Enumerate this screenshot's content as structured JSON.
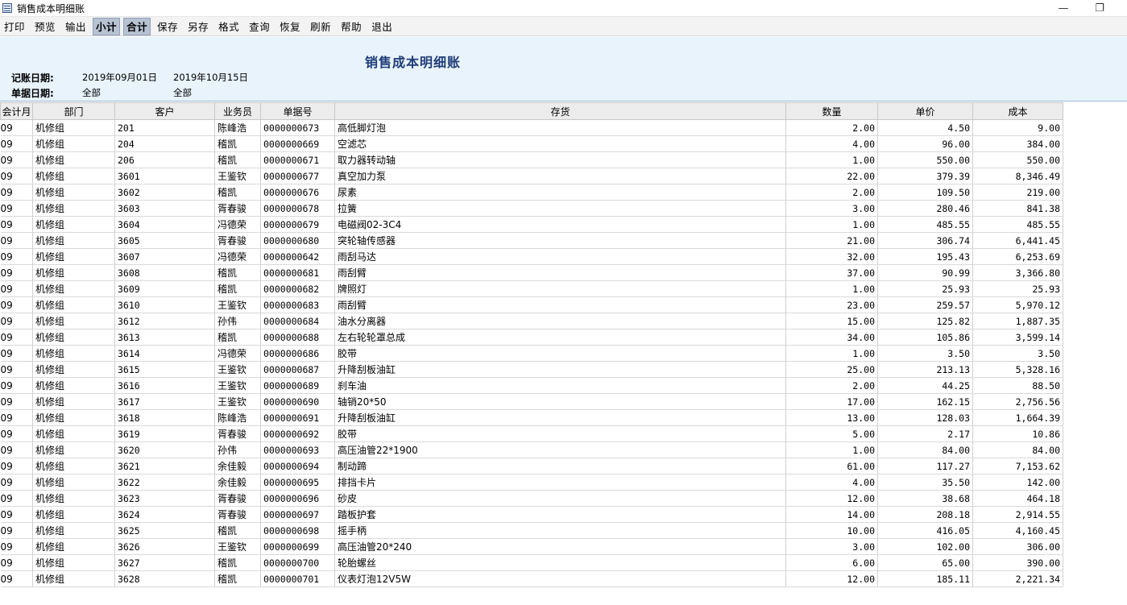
{
  "window": {
    "title": "销售成本明细账"
  },
  "toolbar": [
    "打印",
    "预览",
    "输出",
    "小计",
    "合计",
    "保存",
    "另存",
    "格式",
    "查询",
    "恢复",
    "刷新",
    "帮助",
    "退出"
  ],
  "toolbar_active": [
    "小计",
    "合计"
  ],
  "report": {
    "title": "销售成本明细账",
    "date_label": "记账日期:",
    "date_from": "2019年09月01日",
    "date_to": "2019年10月15日",
    "doc_date_label": "单据日期:",
    "doc_date_from": "全部",
    "doc_date_to": "全部"
  },
  "table": {
    "columns": [
      "会计月",
      "部门",
      "客户",
      "业务员",
      "单据号",
      "存货",
      "数量",
      "单价",
      "成本"
    ],
    "rows": [
      [
        "09",
        "机修组",
        "201",
        "陈峰浩",
        "0000000673",
        "高低脚灯泡",
        "2.00",
        "4.50",
        "9.00"
      ],
      [
        "09",
        "机修组",
        "204",
        "稽凯",
        "0000000669",
        "空滤芯",
        "4.00",
        "96.00",
        "384.00"
      ],
      [
        "09",
        "机修组",
        "206",
        "稽凯",
        "0000000671",
        "取力器转动轴",
        "1.00",
        "550.00",
        "550.00"
      ],
      [
        "09",
        "机修组",
        "3601",
        "王鉴钦",
        "0000000677",
        "真空加力泵",
        "22.00",
        "379.39",
        "8,346.49"
      ],
      [
        "09",
        "机修组",
        "3602",
        "稽凯",
        "0000000676",
        "尿素",
        "2.00",
        "109.50",
        "219.00"
      ],
      [
        "09",
        "机修组",
        "3603",
        "胥春骏",
        "0000000678",
        "拉簧",
        "3.00",
        "280.46",
        "841.38"
      ],
      [
        "09",
        "机修组",
        "3604",
        "冯德荣",
        "0000000679",
        "电磁阀02-3C4",
        "1.00",
        "485.55",
        "485.55"
      ],
      [
        "09",
        "机修组",
        "3605",
        "胥春骏",
        "0000000680",
        "突轮轴传感器",
        "21.00",
        "306.74",
        "6,441.45"
      ],
      [
        "09",
        "机修组",
        "3607",
        "冯德荣",
        "0000000642",
        "雨刮马达",
        "32.00",
        "195.43",
        "6,253.69"
      ],
      [
        "09",
        "机修组",
        "3608",
        "稽凯",
        "0000000681",
        "雨刮臂",
        "37.00",
        "90.99",
        "3,366.80"
      ],
      [
        "09",
        "机修组",
        "3609",
        "稽凯",
        "0000000682",
        "牌照灯",
        "1.00",
        "25.93",
        "25.93"
      ],
      [
        "09",
        "机修组",
        "3610",
        "王鉴钦",
        "0000000683",
        "雨刮臂",
        "23.00",
        "259.57",
        "5,970.12"
      ],
      [
        "09",
        "机修组",
        "3612",
        "孙伟",
        "0000000684",
        "油水分离器",
        "15.00",
        "125.82",
        "1,887.35"
      ],
      [
        "09",
        "机修组",
        "3613",
        "稽凯",
        "0000000688",
        "左右轮轮罩总成",
        "34.00",
        "105.86",
        "3,599.14"
      ],
      [
        "09",
        "机修组",
        "3614",
        "冯德荣",
        "0000000686",
        "胶带",
        "1.00",
        "3.50",
        "3.50"
      ],
      [
        "09",
        "机修组",
        "3615",
        "王鉴钦",
        "0000000687",
        "升降刮板油缸",
        "25.00",
        "213.13",
        "5,328.16"
      ],
      [
        "09",
        "机修组",
        "3616",
        "王鉴钦",
        "0000000689",
        "刹车油",
        "2.00",
        "44.25",
        "88.50"
      ],
      [
        "09",
        "机修组",
        "3617",
        "王鉴钦",
        "0000000690",
        "轴销20*50",
        "17.00",
        "162.15",
        "2,756.56"
      ],
      [
        "09",
        "机修组",
        "3618",
        "陈峰浩",
        "0000000691",
        "升降刮板油缸",
        "13.00",
        "128.03",
        "1,664.39"
      ],
      [
        "09",
        "机修组",
        "3619",
        "胥春骏",
        "0000000692",
        "胶带",
        "5.00",
        "2.17",
        "10.86"
      ],
      [
        "09",
        "机修组",
        "3620",
        "孙伟",
        "0000000693",
        "高压油管22*1900",
        "1.00",
        "84.00",
        "84.00"
      ],
      [
        "09",
        "机修组",
        "3621",
        "余佳毅",
        "0000000694",
        "制动蹄",
        "61.00",
        "117.27",
        "7,153.62"
      ],
      [
        "09",
        "机修组",
        "3622",
        "余佳毅",
        "0000000695",
        "排挡卡片",
        "4.00",
        "35.50",
        "142.00"
      ],
      [
        "09",
        "机修组",
        "3623",
        "胥春骏",
        "0000000696",
        "砂皮",
        "12.00",
        "38.68",
        "464.18"
      ],
      [
        "09",
        "机修组",
        "3624",
        "胥春骏",
        "0000000697",
        "踏板护套",
        "14.00",
        "208.18",
        "2,914.55"
      ],
      [
        "09",
        "机修组",
        "3625",
        "稽凯",
        "0000000698",
        "摇手柄",
        "10.00",
        "416.05",
        "4,160.45"
      ],
      [
        "09",
        "机修组",
        "3626",
        "王鉴钦",
        "0000000699",
        "高压油管20*240",
        "3.00",
        "102.00",
        "306.00"
      ],
      [
        "09",
        "机修组",
        "3627",
        "稽凯",
        "0000000700",
        "轮胎螺丝",
        "6.00",
        "65.00",
        "390.00"
      ],
      [
        "09",
        "机修组",
        "3628",
        "稽凯",
        "0000000701",
        "仪表灯泡12V5W",
        "12.00",
        "185.11",
        "2,221.34"
      ]
    ]
  }
}
